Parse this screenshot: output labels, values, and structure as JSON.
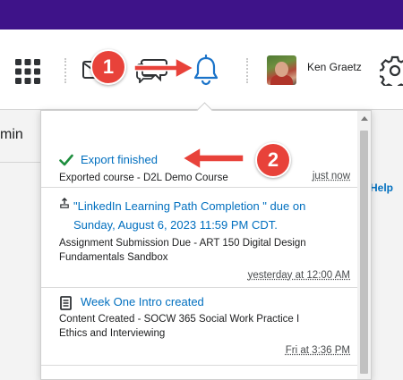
{
  "nav": {
    "user_name": "Ken Graetz",
    "icons": [
      "waffle-grid-icon",
      "mail-icon",
      "chat-icon",
      "bell-icon",
      "gear-icon"
    ]
  },
  "annotations": {
    "badge_1": "1",
    "badge_2": "2",
    "color": "#e8423a"
  },
  "page": {
    "left_text": "min",
    "help_link": "Help"
  },
  "notifications": {
    "items": [
      {
        "icon": "checkmark-icon",
        "title": "Export finished",
        "subtitle": "Exported course - D2L Demo Course",
        "time": "just now"
      },
      {
        "icon": "upload-icon",
        "title_line1": "\"LinkedIn Learning Path Completion \" due on",
        "title_line2": "Sunday, August 6, 2023 11:59 PM CDT.",
        "subtitle_line1": "Assignment Submission Due - ART 150 Digital Design",
        "subtitle_line2": "Fundamentals Sandbox",
        "time": "yesterday at 12:00 AM"
      },
      {
        "icon": "document-icon",
        "title": "Week One Intro created",
        "subtitle_line1": "Content Created - SOCW 365 Social Work Practice I",
        "subtitle_line2": "Ethics and Interviewing",
        "time": "Fri at 3:36 PM"
      }
    ]
  },
  "colors": {
    "top_bar": "#3e1389",
    "link": "#006fbf",
    "check": "#1e8e3e"
  }
}
